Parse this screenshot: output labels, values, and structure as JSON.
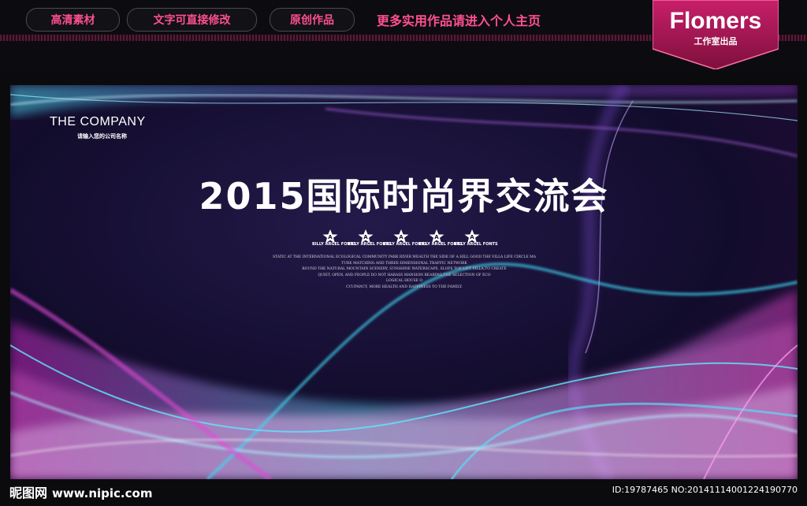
{
  "toolbar": {
    "pills": [
      "高清素材",
      "文字可直接修改",
      "原创作品"
    ],
    "more_link": "更多实用作品请进入个人主页"
  },
  "brand": {
    "name": "Flomers",
    "sub": "工作室出品",
    "badge_color": "#b8195e"
  },
  "banner": {
    "company_name": "THE COMPANY",
    "company_sub": "请输入您的公司名称",
    "title": "2015国际时尚界交流会",
    "star_letter": "A",
    "star_captions": [
      "BILLY ARGEL FONTS",
      "BILLY ARGEL FONTS",
      "BILLY ARGEL FONTS",
      "BILLY ARGEL FONTS",
      "BILLY ARGEL FONTS"
    ],
    "body_lines": [
      "STATIC AT THE INTERNATIONAL ECOLOGICAL COMMUNITY PARK RIVER WEALTH THE SIDE OF A HILL GOOD THE VILLA LIFE CIRCLE MA",
      "TURE MATCHING AND THREE-DIMENSIONAL TRAFFIC NETWORK",
      "ROUND THE NATURAL MOUNTAIN SCENERY, SUNSHINE WATERSCAPE, SLOPE TOP LIFT VILLA,TO CREATE",
      "QUIET, OPEN, AND PEOPLE DO NOT HARASS MANSION BEARING,THE SELECTION OF ECO",
      "LOGICAL HOUSE O",
      "CCUPANCY, MORE HEALTH AND HAPPINESS TO THE FAMILY."
    ],
    "colors": {
      "cyan": "#3fd8f2",
      "magenta": "#e03ad6",
      "violet": "#7b3fe0",
      "navy": "#1a1440"
    }
  },
  "footer": {
    "site_logo": "昵图网",
    "site_url": "www.nipic.com",
    "image_id": "ID:19787465 NO:20141114001224190770"
  }
}
